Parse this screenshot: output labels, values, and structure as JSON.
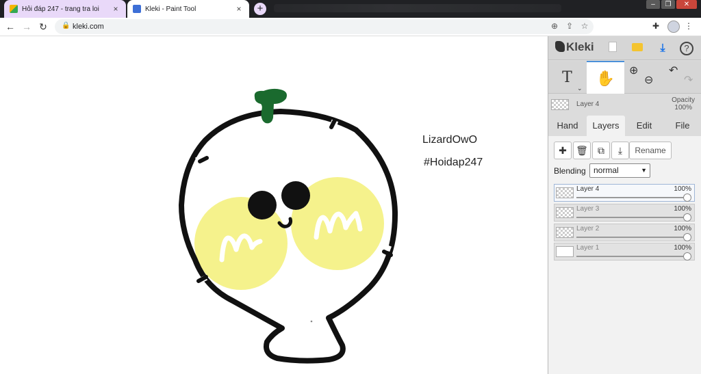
{
  "browser": {
    "tabs": [
      {
        "title": "Hỏi đáp 247 - trang tra loi",
        "close": "×"
      },
      {
        "title": "Kleki - Paint Tool",
        "close": "×"
      }
    ],
    "new_tab": "+",
    "url": "kleki.com",
    "window_controls": [
      "–",
      "❐",
      "✕"
    ]
  },
  "canvas": {
    "texts": [
      "LizardOwO",
      "#Hoidap247"
    ]
  },
  "panel": {
    "logo": "Kleki",
    "current_layer": {
      "name": "Layer 4",
      "opacity_label": "Opacity",
      "opacity_value": "100%"
    },
    "tabs": [
      "Hand",
      "Layers",
      "Edit",
      "File"
    ],
    "active_tab": "Layers",
    "rename_label": "Rename",
    "blending_label": "Blending",
    "blending_value": "normal",
    "layers": [
      {
        "name": "Layer 4",
        "opacity": "100%"
      },
      {
        "name": "Layer 3",
        "opacity": "100%"
      },
      {
        "name": "Layer 2",
        "opacity": "100%"
      },
      {
        "name": "Layer 1",
        "opacity": "100%"
      }
    ],
    "icons": [
      "new-file-icon",
      "open-folder-icon",
      "download-icon",
      "help-icon",
      "text-tool-icon",
      "hand-tool-icon",
      "zoom-in-icon",
      "zoom-out-icon",
      "undo-icon",
      "redo-icon",
      "add-layer-icon",
      "delete-layer-icon",
      "duplicate-layer-icon",
      "merge-layer-icon"
    ]
  },
  "colors": {
    "leaf": "#1a6a2e",
    "cheek": "#f5f28c",
    "outline": "#111111",
    "active_tool_accent": "#4a90d9"
  }
}
